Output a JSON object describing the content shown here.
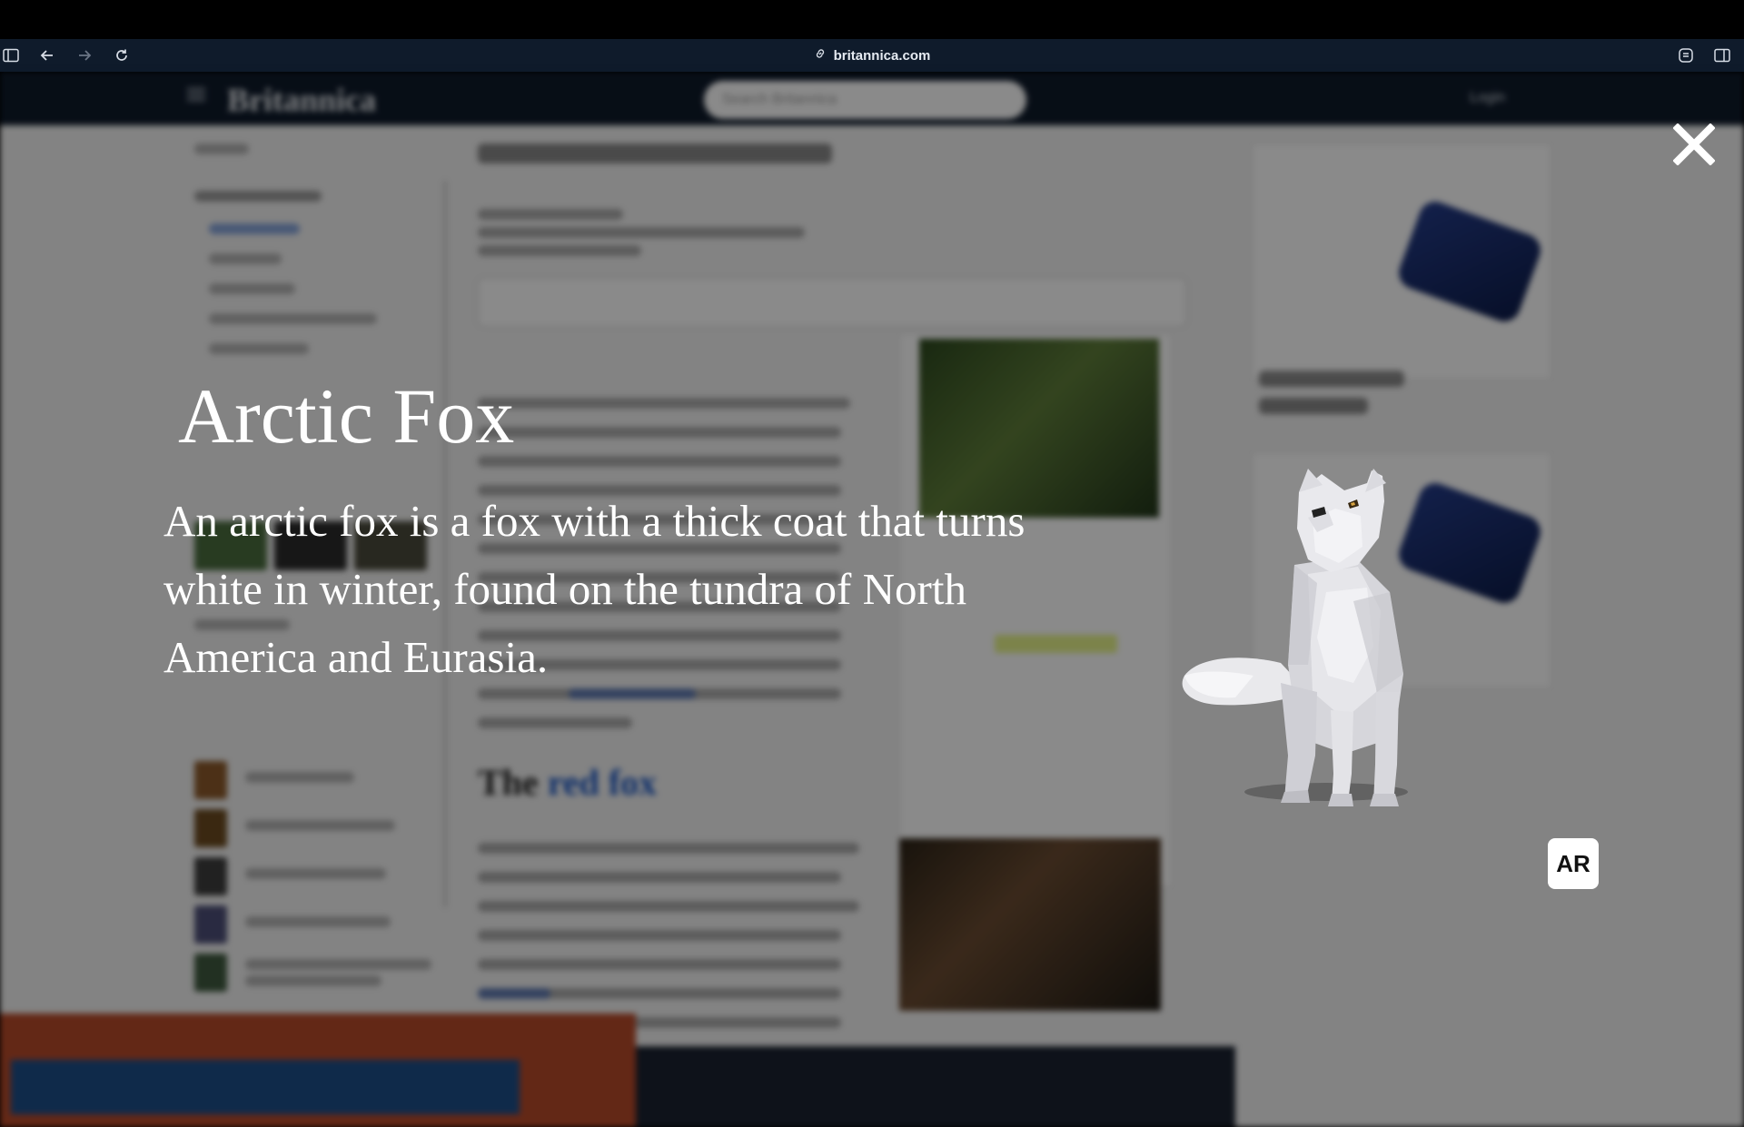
{
  "browser": {
    "url": "britannica.com"
  },
  "site": {
    "logo": "Britannica",
    "search_placeholder": "Search Britannica",
    "login": "Login"
  },
  "article": {
    "section_heading_prefix": "The",
    "section_heading_link": "red fox"
  },
  "modal": {
    "title": "Arctic Fox",
    "description": "An arctic fox is a fox with a thick coat that turns white in winter, found on the tundra of North America and Eurasia.",
    "ar_label": "AR"
  }
}
